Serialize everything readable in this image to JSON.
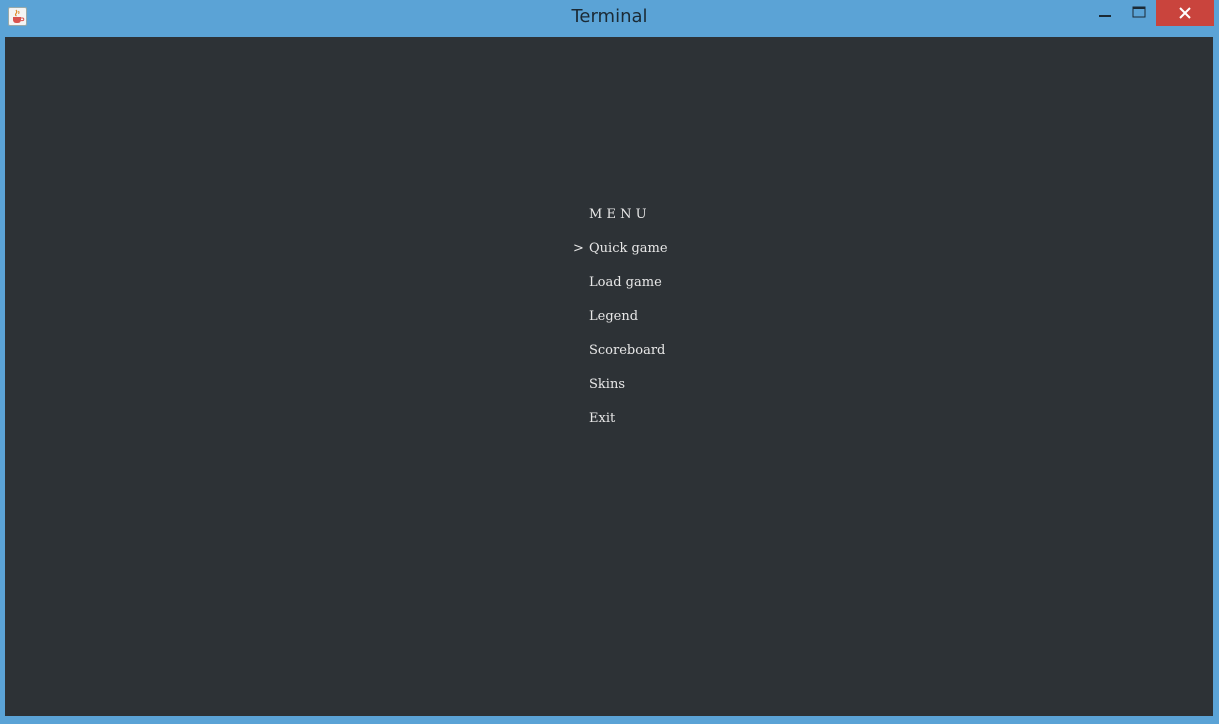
{
  "window": {
    "title": "Terminal",
    "icon": "java-cup-icon"
  },
  "colors": {
    "titlebar": "#5ba3d6",
    "terminal_bg": "#2d3236",
    "text": "#e8e8e8",
    "close_button": "#c9443d"
  },
  "menu": {
    "heading": "M E N U",
    "cursor": ">",
    "items": [
      {
        "label": "Quick game",
        "selected": true
      },
      {
        "label": "Load game",
        "selected": false
      },
      {
        "label": "Legend",
        "selected": false
      },
      {
        "label": "Scoreboard",
        "selected": false
      },
      {
        "label": "Skins",
        "selected": false
      },
      {
        "label": "Exit",
        "selected": false
      }
    ]
  }
}
